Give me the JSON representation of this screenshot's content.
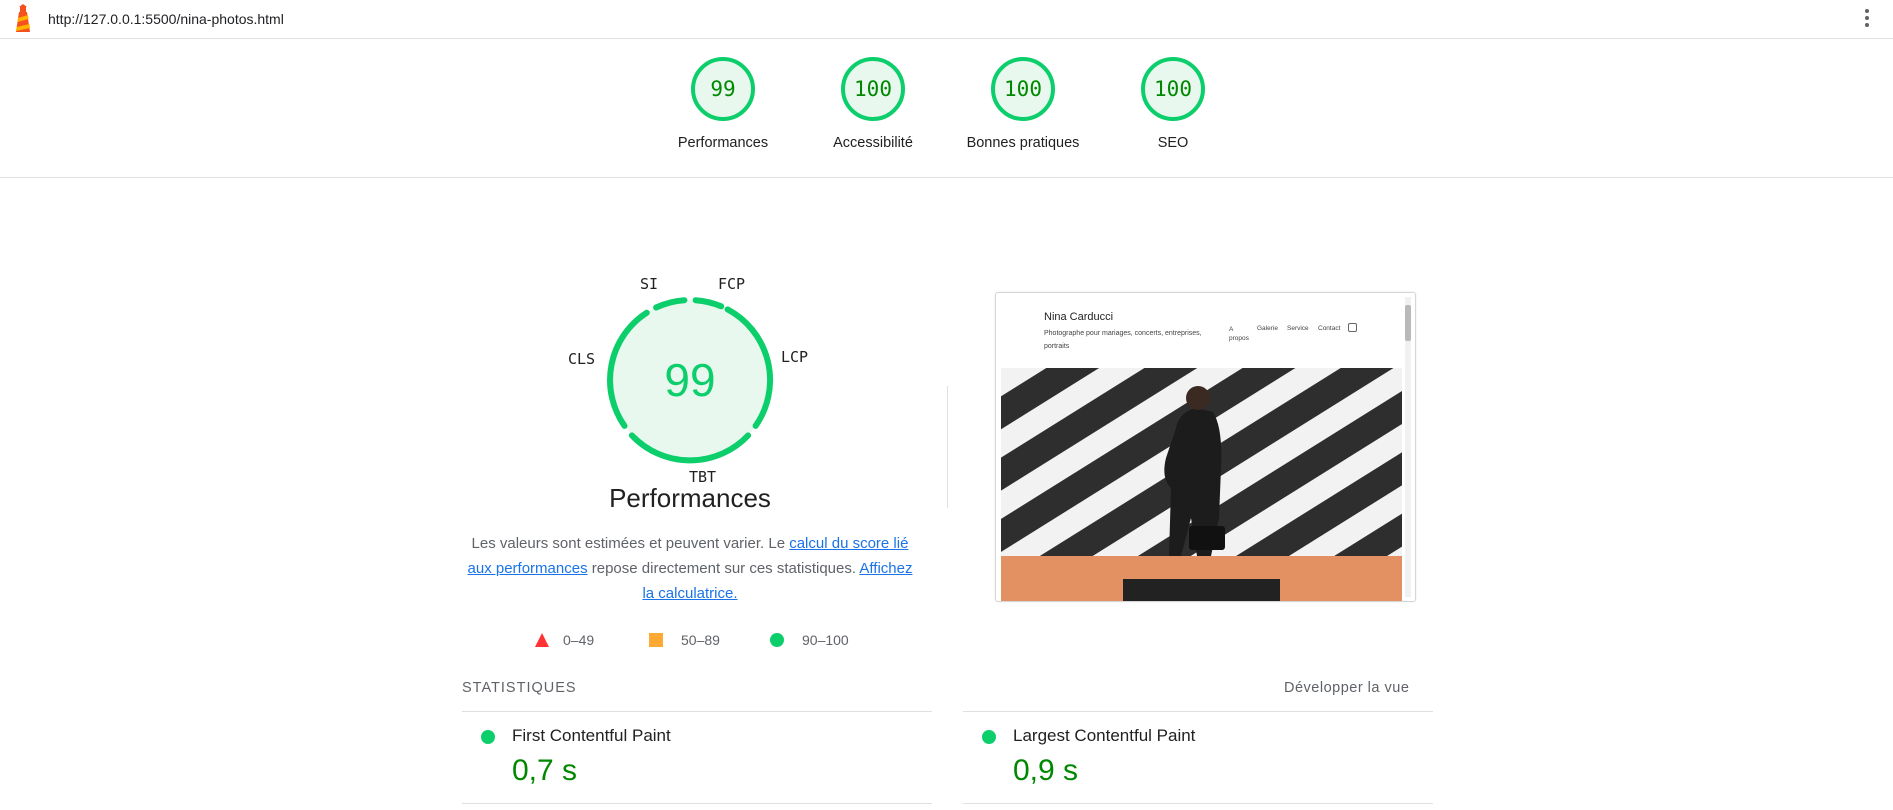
{
  "browser": {
    "url": "http://127.0.0.1:5500/nina-photos.html",
    "logo_icon": "lighthouse-icon",
    "menu_icon": "kebab-menu-icon"
  },
  "summary_scores": [
    {
      "label": "Performances",
      "score": "99"
    },
    {
      "label": "Accessibilité",
      "score": "100"
    },
    {
      "label": "Bonnes pratiques",
      "score": "100"
    },
    {
      "label": "SEO",
      "score": "100"
    }
  ],
  "performance": {
    "score": "99",
    "title": "Performances",
    "metric_labels": {
      "si": "SI",
      "fcp": "FCP",
      "lcp": "LCP",
      "tbt": "TBT",
      "cls": "CLS"
    },
    "description": {
      "part1": "Les valeurs sont estimées et peuvent varier. Le ",
      "link1": "calcul du score lié aux performances",
      "part2": " repose directement sur ces statistiques. ",
      "link2": "Affichez la calculatrice."
    },
    "legend": {
      "fail": "0–49",
      "average": "50–89",
      "pass": "90–100"
    }
  },
  "screenshot": {
    "site_name": "Nina Carducci",
    "tagline": "Photographe pour mariages, concerts, entreprises, portraits",
    "nav": [
      "A propos",
      "Galerie",
      "Service",
      "Contact"
    ],
    "instagram_icon": "instagram-icon"
  },
  "stats": {
    "heading": "STATISTIQUES",
    "expand_label": "Développer la vue",
    "items": [
      {
        "name": "First Contentful Paint",
        "value": "0,7 s"
      },
      {
        "name": "Largest Contentful Paint",
        "value": "0,9 s"
      }
    ]
  },
  "colors": {
    "pass": "#0cce6b",
    "pass_text": "#008800",
    "average": "#ffaa33",
    "fail": "#ff3333",
    "link": "#1a73e8"
  }
}
